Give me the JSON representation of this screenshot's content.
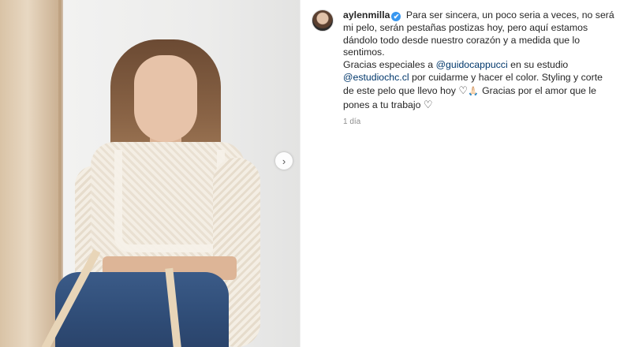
{
  "post": {
    "username": "aylenmilla",
    "verified_mark": "✔",
    "caption": {
      "part1": "Para ser sincera, un poco seria a veces, no será mi pelo, serán pestañas postizas hoy, pero aquí estamos dándolo todo desde nuestro corazón y a medida que lo sentimos.",
      "part2": "Gracias especiales a",
      "mention1": "@guidocappucci",
      "part3": "en su estudio",
      "mention2": "@estudiochc.cl",
      "part4": "por cuidarme y hacer el color. Styling y corte de este pelo que llevo hoy",
      "heart1": "♡",
      "hands": "🙏🏻",
      "part5": "Gracias por el amor que le pones a tu trabajo",
      "heart2": "♡"
    },
    "timestamp": "1 día"
  },
  "carousel": {
    "next_arrow": "›"
  },
  "icons": {
    "avatar": "avatar",
    "verified": "verified-badge-icon",
    "next": "chevron-right-icon",
    "heart": "heart-outline-icon"
  },
  "colors": {
    "text": "#262626",
    "mention": "#00376b",
    "verified": "#3897f0",
    "muted": "#8e8e8e"
  }
}
